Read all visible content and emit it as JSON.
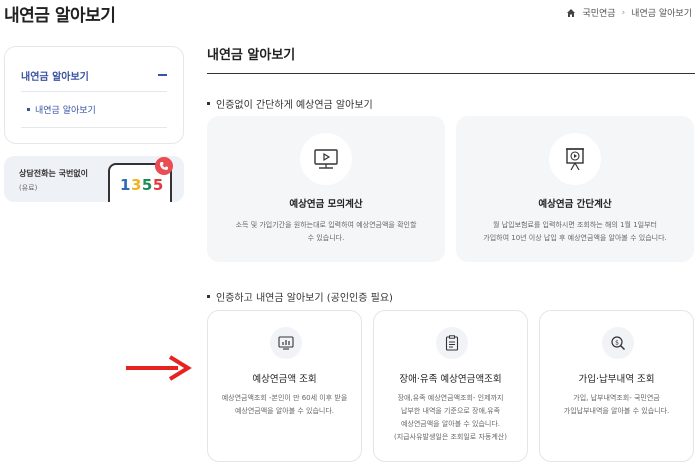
{
  "header": {
    "page_title": "내연금 알아보기",
    "breadcrumb": [
      "국민연금",
      "내연금 알아보기"
    ]
  },
  "sidebar": {
    "menu_title": "내연금 알아보기",
    "sub_item": "내연금 알아보기",
    "call_card": {
      "line1": "상담전화는 국번없이",
      "line2": "(유료)",
      "number_digits": [
        "1",
        "3",
        "5",
        "5"
      ]
    }
  },
  "main": {
    "title": "내연금 알아보기",
    "section1": {
      "heading": "인증없이 간단하게 예상연금 알아보기",
      "cards": [
        {
          "title": "예상연금 모의계산",
          "icon": "monitor-play-icon",
          "desc": "소득 및 가입기간을 원하는대로 입력하여 예상연금액을 확인할\n수 있습니다."
        },
        {
          "title": "예상연금 간단계산",
          "icon": "screen-play-icon",
          "desc": "월 납입보험료를 입력하시면 조회하는 해의 1월 1일부터\n가입하여 10년 이상 납입 후 예상연금액을 알아볼 수 있습니다."
        }
      ]
    },
    "section2": {
      "heading": "인증하고 내연금 알아보기 (공인인증 필요)",
      "cards": [
        {
          "title": "예상연금액 조회",
          "icon": "chart-card-icon",
          "desc": "예상연금액조회 -본인이 만 60세 이후 받을\n예상연금액을 알아볼 수 있습니다."
        },
        {
          "title": "장애·유족 예상연금액조회",
          "icon": "document-icon",
          "desc": "장애,유족 예상연금액조회- 인제까지\n납부한 내역을 기준으로 장애,유족\n예상연금액을 알아볼 수 있습니다.\n(지급사유발생일은 조회일로 자동계산)"
        },
        {
          "title": "가입·납부내역 조회",
          "icon": "search-coin-icon",
          "desc": "가입, 납부내역조회- 국민연금\n가입납부내역을 알아볼 수 있습니다."
        }
      ]
    }
  },
  "annotation": {
    "arrow_color": "#e8231f"
  }
}
